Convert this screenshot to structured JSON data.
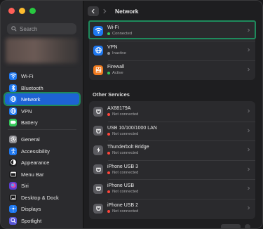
{
  "window": {
    "traffic_colors": [
      "#ff5f57",
      "#febc2e",
      "#28c840"
    ]
  },
  "sidebar": {
    "search_placeholder": "Search",
    "items": [
      {
        "label": "Wi-Fi",
        "icon": "wifi-icon",
        "color": "#1e78f0"
      },
      {
        "label": "Bluetooth",
        "icon": "bluetooth-icon",
        "color": "#1e78f0"
      },
      {
        "label": "Network",
        "icon": "network-globe-icon",
        "color": "#1e78f0",
        "selected": true
      },
      {
        "label": "VPN",
        "icon": "vpn-globe-icon",
        "color": "#1e78f0"
      },
      {
        "label": "Battery",
        "icon": "battery-icon",
        "color": "#34c759"
      },
      {
        "label": "General",
        "icon": "gear-icon",
        "color": "#8e8e93"
      },
      {
        "label": "Accessibility",
        "icon": "accessibility-icon",
        "color": "#1e78f0"
      },
      {
        "label": "Appearance",
        "icon": "appearance-icon",
        "color": "#1c1c1e"
      },
      {
        "label": "Menu Bar",
        "icon": "menu-bar-icon",
        "color": "#1c1c1e"
      },
      {
        "label": "Siri",
        "icon": "siri-icon",
        "color": "#5a3fd0"
      },
      {
        "label": "Desktop & Dock",
        "icon": "desktop-dock-icon",
        "color": "#1c1c1e"
      },
      {
        "label": "Displays",
        "icon": "displays-icon",
        "color": "#1e78f0"
      },
      {
        "label": "Spotlight",
        "icon": "spotlight-icon",
        "color": "#5856d6"
      }
    ]
  },
  "header": {
    "title": "Network"
  },
  "primary_services": [
    {
      "name": "Wi-Fi",
      "status": "Connected",
      "status_color": "#34c759",
      "icon": "wifi-icon",
      "icon_color": "#1e78f0"
    },
    {
      "name": "VPN",
      "status": "Inactive",
      "status_color": "#8e8e93",
      "icon": "vpn-globe-icon",
      "icon_color": "#1e78f0"
    },
    {
      "name": "Firewall",
      "status": "Active",
      "status_color": "#34c759",
      "icon": "firewall-icon",
      "icon_color": "#f07a1e"
    }
  ],
  "other_services_heading": "Other Services",
  "other_services": [
    {
      "name": "AX88179A",
      "status": "Not connected",
      "icon": "ethernet-icon"
    },
    {
      "name": "USB 10/100/1000 LAN",
      "status": "Not connected",
      "icon": "ethernet-icon"
    },
    {
      "name": "Thunderbolt Bridge",
      "status": "Not connected",
      "icon": "thunderbolt-icon"
    },
    {
      "name": "iPhone USB 3",
      "status": "Not connected",
      "icon": "ethernet-icon"
    },
    {
      "name": "iPhone USB",
      "status": "Not connected",
      "icon": "ethernet-icon"
    },
    {
      "name": "iPhone USB 2",
      "status": "Not connected",
      "icon": "ethernet-icon"
    }
  ],
  "other_status_color": "#ff453a"
}
